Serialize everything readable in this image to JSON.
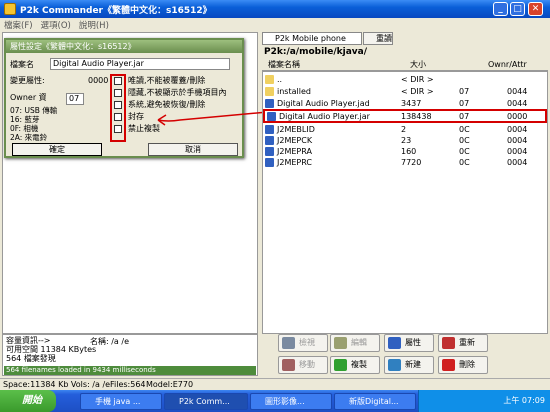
{
  "window": {
    "title": "P2k Commander《繁體中文化：s16512》",
    "min": "_",
    "max": "□",
    "close": "✕"
  },
  "menu": [
    "檔案(F)",
    "選項(O)",
    "說明(H)"
  ],
  "left_panel": {
    "numbers": [
      "21",
      "21",
      "13"
    ]
  },
  "dialog": {
    "title": "屬性設定《繁體中文化：s16512》",
    "file_label": "檔案名",
    "file_value": "Digital Audio Player.jar",
    "attr_label": "變更屬性:",
    "attr_value": "0000",
    "owner_label": "Owner 資",
    "owner_value": "07",
    "notes": [
      "07: USB 傳輸",
      "16: 藍芽",
      "0F: 相機",
      "2A: 來電鈴"
    ],
    "options": [
      "唯讀,不能被覆蓋/刪除",
      "隱藏,不被顯示於手機項目內",
      "系統,避免被恢復/刪除",
      "封存",
      "禁止複製"
    ],
    "ok": "確定",
    "cancel": "取消"
  },
  "right_panel": {
    "drive": "P2k Mobile phone",
    "refresh": "重讀",
    "path": "P2k:/a/mobile/kjava/",
    "headers": [
      "檔案名稱",
      "大小",
      "Ownr/Attr"
    ],
    "rows": [
      {
        "name": "..",
        "size": "< DIR >",
        "own": "",
        "attr": "",
        "type": "up"
      },
      {
        "name": "installed",
        "size": "< DIR >",
        "own": "07",
        "attr": "0044",
        "type": "folder"
      },
      {
        "name": "Digital Audio Player.jad",
        "size": "3437",
        "own": "07",
        "attr": "0044",
        "type": "file"
      },
      {
        "name": "Digital Audio Player.jar",
        "size": "138438",
        "own": "07",
        "attr": "0000",
        "type": "file",
        "selected": true
      },
      {
        "name": "J2MEBLID",
        "size": "2",
        "own": "0C",
        "attr": "0004",
        "type": "file"
      },
      {
        "name": "J2MEPCK",
        "size": "23",
        "own": "0C",
        "attr": "0004",
        "type": "file"
      },
      {
        "name": "J2MEPRA",
        "size": "160",
        "own": "0C",
        "attr": "0004",
        "type": "file"
      },
      {
        "name": "J2MEPRC",
        "size": "7720",
        "own": "0C",
        "attr": "0004",
        "type": "file"
      }
    ]
  },
  "info": {
    "lines": [
      "容量資訊-->",
      "可用空間   11384 KBytes",
      "564 檔案發現"
    ],
    "name_label": "名稱: /a /e",
    "loading": "564 filenames loaded in 9434 milliseconds"
  },
  "actions": [
    {
      "label": "檢視",
      "color": "#7a8aa0",
      "enabled": false
    },
    {
      "label": "編輯",
      "color": "#9aa070",
      "enabled": false
    },
    {
      "label": "屬性",
      "color": "#3060c0",
      "enabled": true
    },
    {
      "label": "重新",
      "color": "#c03030",
      "enabled": true
    },
    {
      "label": "移動",
      "color": "#a06060",
      "enabled": false
    },
    {
      "label": "複製",
      "color": "#30a030",
      "enabled": true
    },
    {
      "label": "新建",
      "color": "#3080c0",
      "enabled": true
    },
    {
      "label": "刪除",
      "color": "#d02020",
      "enabled": true
    }
  ],
  "status": {
    "space": "Space:11384 Kb  Vols: /a /e",
    "files": "Files:564",
    "model": "Model:E770"
  },
  "taskbar": {
    "start": "開始",
    "tasks": [
      "手機 java ...",
      "P2k Comm...",
      "圖形影像...",
      "新版Digital..."
    ],
    "clock": "上午 07:09"
  }
}
